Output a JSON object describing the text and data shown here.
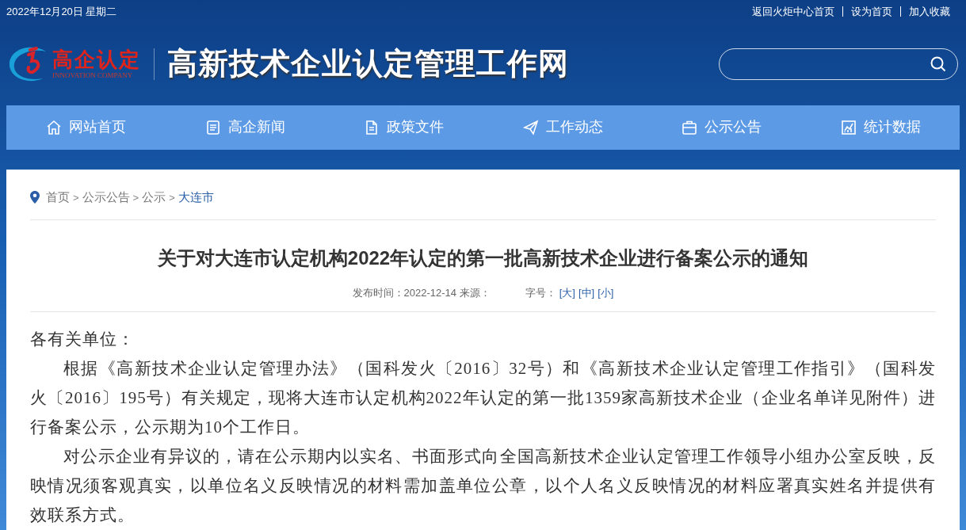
{
  "top_bar": {
    "date": "2022年12月20日 星期二",
    "links": [
      "返回火炬中心首页",
      "设为首页",
      "加入收藏"
    ]
  },
  "logo": {
    "name": "高企认定",
    "subtitle": "INNOVATION COMPANY"
  },
  "site_title": "高新技术企业认定管理工作网",
  "nav": [
    {
      "label": "网站首页",
      "kind": "home"
    },
    {
      "label": "高企新闻",
      "kind": "news"
    },
    {
      "label": "政策文件",
      "kind": "doc"
    },
    {
      "label": "工作动态",
      "kind": "plane"
    },
    {
      "label": "公示公告",
      "kind": "board"
    },
    {
      "label": "统计数据",
      "kind": "chart"
    }
  ],
  "breadcrumb": [
    {
      "label": "首页",
      "current": false
    },
    {
      "separator": ">",
      "label": "公示公告",
      "current": false
    },
    {
      "separator": ">",
      "label": "公示",
      "current": false
    },
    {
      "separator": ">",
      "label": "大连市",
      "current": true
    }
  ],
  "article": {
    "title": "关于对大连市认定机构2022年认定的第一批高新技术企业进行备案公示的通知",
    "meta": "发布时间：2022-12-14 来源：",
    "font_size_label": "字号：",
    "font_sizes": [
      "[大]",
      "[中]",
      "[小]"
    ],
    "paragraphs": [
      {
        "text": "各有关单位：",
        "indent": false
      },
      {
        "text": "根据《高新技术企业认定管理办法》（国科发火〔2016〕32号）和《高新技术企业认定管理工作指引》（国科发火〔2016〕195号）有关规定，现将大连市认定机构2022年认定的第一批1359家高新技术企业（企业名单详见附件）进行备案公示，公示期为10个工作日。",
        "indent": true
      },
      {
        "text": "对公示企业有异议的，请在公示期内以实名、书面形式向全国高新技术企业认定管理工作领导小组办公室反映，反映情况须客观真实，以单位名义反映情况的材料需加盖单位公章，以个人名义反映情况的材料应署真实姓名并提供有效联系方式。",
        "indent": true
      }
    ]
  }
}
